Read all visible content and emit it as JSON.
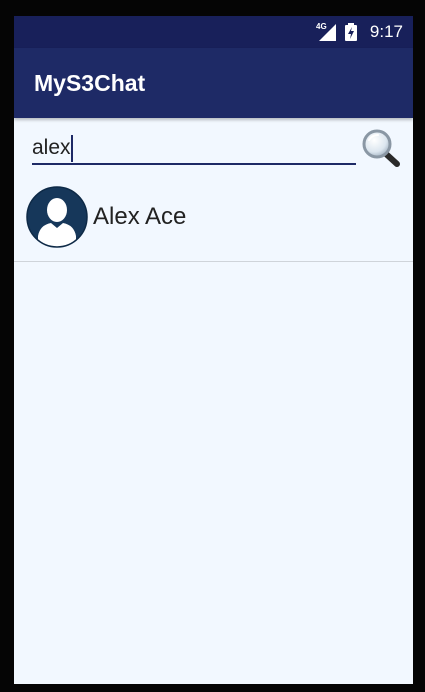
{
  "status_bar": {
    "time": "9:17",
    "network": "4G",
    "icons": [
      "signal-icon",
      "battery-charging-icon"
    ]
  },
  "app_bar": {
    "title": "MyS3Chat"
  },
  "search": {
    "value": "alex",
    "icon": "search-icon"
  },
  "contacts": [
    {
      "name": "Alex Ace",
      "avatar": "default-avatar-icon"
    }
  ],
  "colors": {
    "primary": "#1e2a66",
    "primary_dark": "#18205a",
    "background": "#f2f8ff",
    "avatar_bg": "#1a3a5c"
  }
}
